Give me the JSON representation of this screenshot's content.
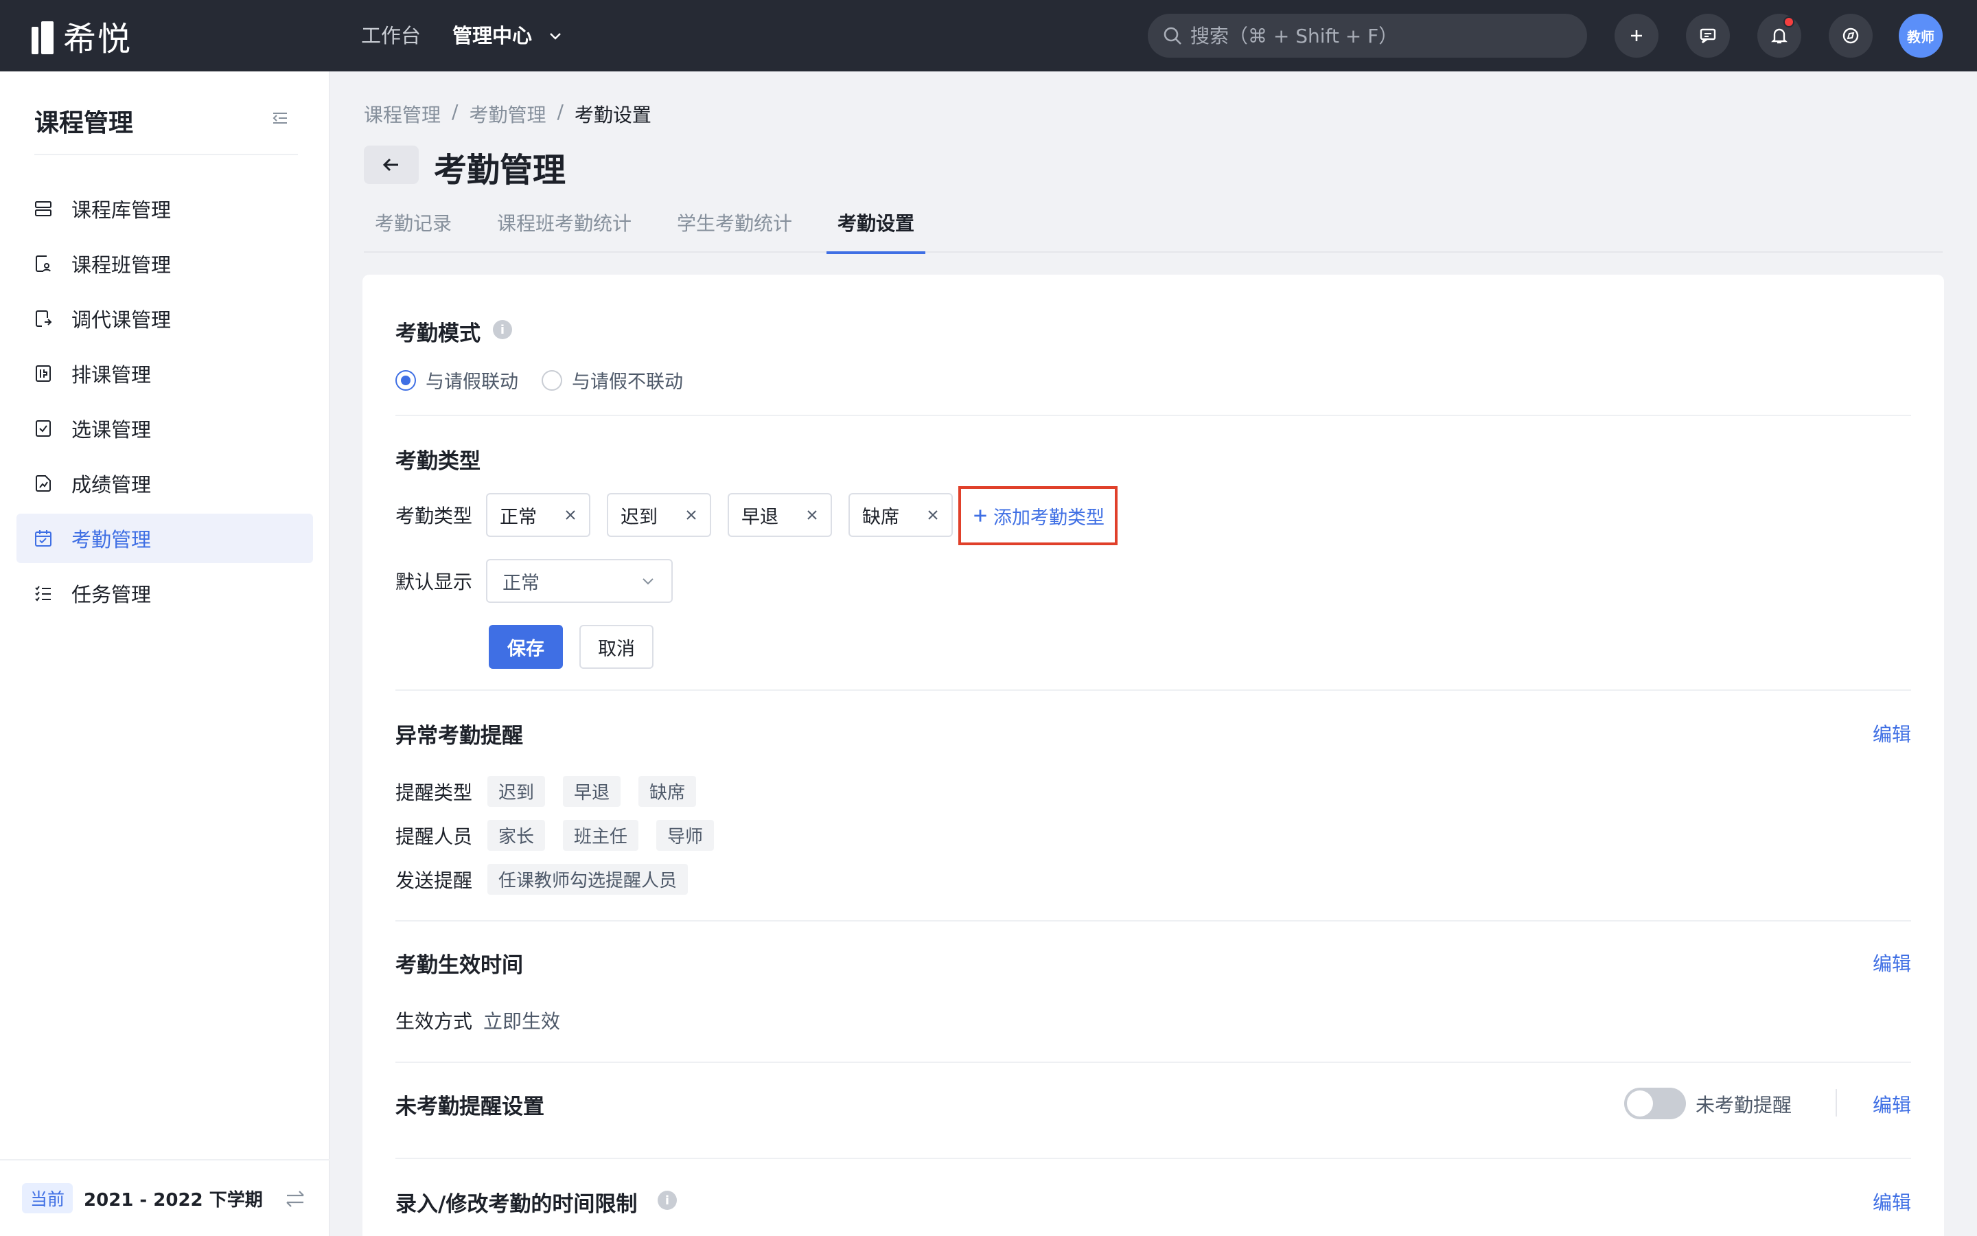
{
  "app": {
    "logo_text": "希悦"
  },
  "topnav": {
    "workbench": "工作台",
    "admin_center": "管理中心"
  },
  "search": {
    "placeholder": "搜索（⌘ + Shift + F）"
  },
  "user": {
    "avatar_text": "教师"
  },
  "sidebar": {
    "title": "课程管理",
    "items": [
      {
        "label": "课程库管理",
        "icon": "course-library-icon"
      },
      {
        "label": "课程班管理",
        "icon": "class-icon"
      },
      {
        "label": "调代课管理",
        "icon": "substitute-icon"
      },
      {
        "label": "排课管理",
        "icon": "schedule-icon"
      },
      {
        "label": "选课管理",
        "icon": "select-course-icon"
      },
      {
        "label": "成绩管理",
        "icon": "grade-icon"
      },
      {
        "label": "考勤管理",
        "icon": "calendar-check-icon",
        "active": true
      },
      {
        "label": "任务管理",
        "icon": "task-list-icon"
      }
    ],
    "footer": {
      "badge": "当前",
      "term": "2021 - 2022 下学期"
    }
  },
  "breadcrumb": [
    "课程管理",
    "考勤管理",
    "考勤设置"
  ],
  "page": {
    "title": "考勤管理"
  },
  "tabs": [
    "考勤记录",
    "课程班考勤统计",
    "学生考勤统计",
    "考勤设置"
  ],
  "active_tab": "考勤设置",
  "mode": {
    "title": "考勤模式",
    "options": [
      "与请假联动",
      "与请假不联动"
    ],
    "selected": "与请假联动"
  },
  "types": {
    "title": "考勤类型",
    "label": "考勤类型",
    "tags": [
      "正常",
      "迟到",
      "早退",
      "缺席"
    ],
    "add_label": "添加考勤类型",
    "default_label": "默认显示",
    "default_value": "正常",
    "save": "保存",
    "cancel": "取消"
  },
  "abnormal": {
    "title": "异常考勤提醒",
    "edit": "编辑",
    "remind_type_label": "提醒类型",
    "remind_types": [
      "迟到",
      "早退",
      "缺席"
    ],
    "remind_people_label": "提醒人员",
    "remind_people": [
      "家长",
      "班主任",
      "导师"
    ],
    "send_label": "发送提醒",
    "send_value": "任课教师勾选提醒人员"
  },
  "effective": {
    "title": "考勤生效时间",
    "edit": "编辑",
    "mode_label": "生效方式",
    "mode_value": "立即生效"
  },
  "unchecked": {
    "title": "未考勤提醒设置",
    "toggle_label": "未考勤提醒",
    "toggle_on": false,
    "edit": "编辑"
  },
  "time_limit": {
    "title": "录入/修改考勤的时间限制",
    "edit": "编辑"
  },
  "colors": {
    "primary": "#3f6fe4",
    "topbar": "#262a34",
    "highlight_border": "#e0402a"
  }
}
